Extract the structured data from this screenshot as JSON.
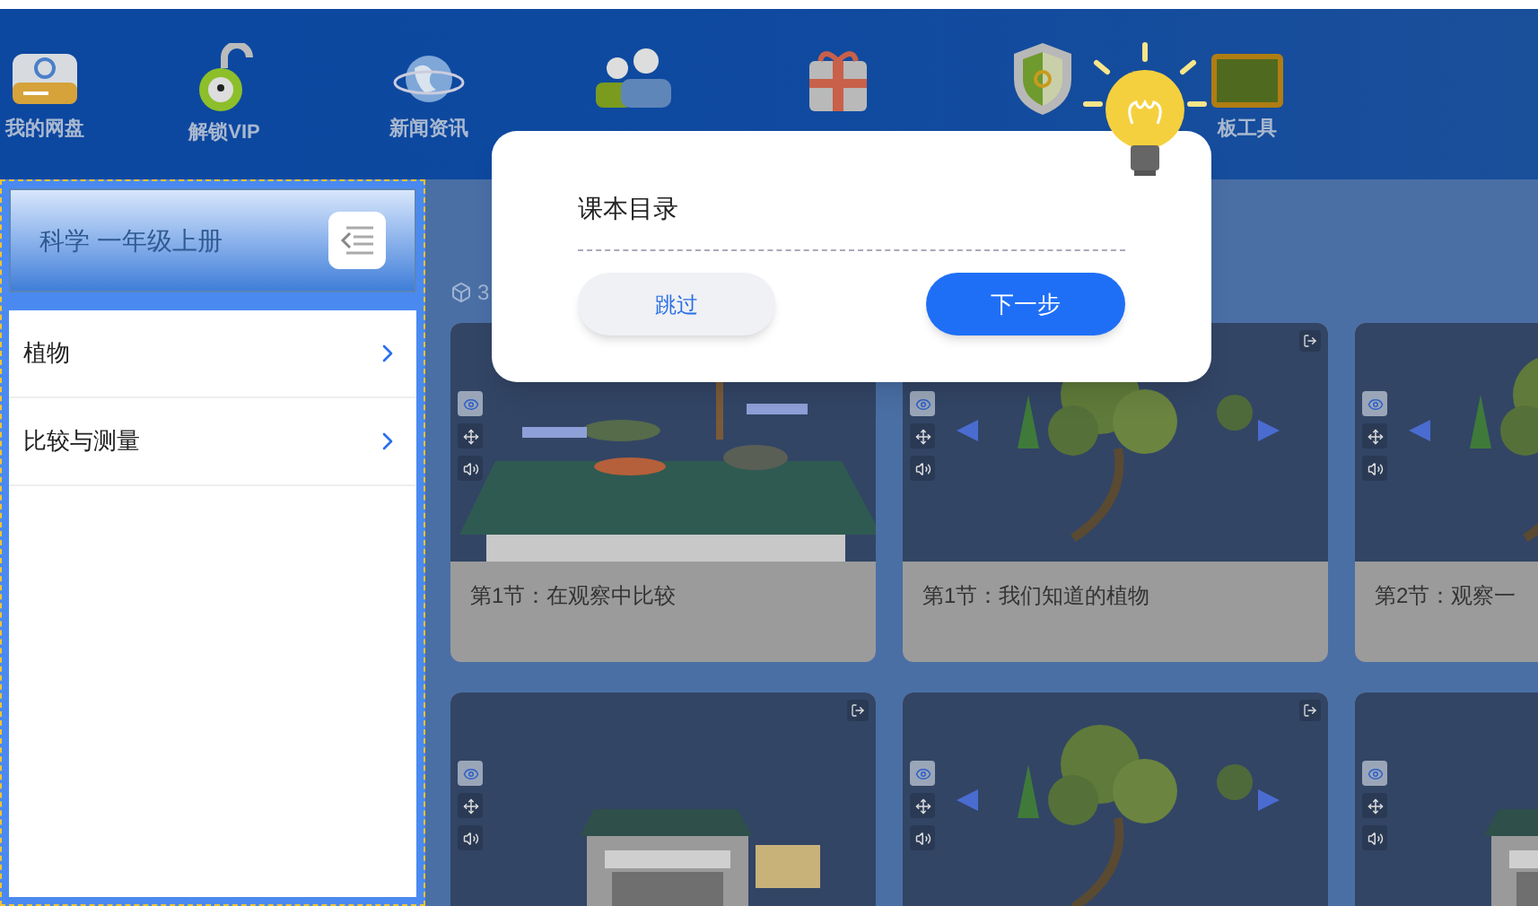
{
  "toolbar": {
    "items": [
      {
        "label": "我的网盘",
        "kind": "disk"
      },
      {
        "label": "解锁VIP",
        "kind": "lock"
      },
      {
        "label": "新闻资讯",
        "kind": "globe"
      },
      {
        "kind": "people"
      },
      {
        "kind": "gift"
      },
      {
        "kind": "shield"
      },
      {
        "label": "板工具",
        "kind": "board"
      }
    ]
  },
  "sidebar": {
    "title": "科学 一年级上册",
    "items": [
      {
        "label": "植物"
      },
      {
        "label": "比较与测量"
      }
    ]
  },
  "section": {
    "label": "3"
  },
  "cards": [
    {
      "title": "第1节：在观察中比较",
      "kind": "dino",
      "exit": false
    },
    {
      "title": "第1节：我们知道的植物",
      "kind": "tree",
      "exit": true
    },
    {
      "title": "第2节：观察一",
      "kind": "tree",
      "exit": false
    },
    {
      "kind": "desk",
      "exit": true
    },
    {
      "kind": "tree",
      "exit": true
    },
    {
      "kind": "desk",
      "exit": false
    }
  ],
  "popup": {
    "title": "课本目录",
    "buttons": [
      {
        "label": "跳过",
        "kind": "secondary"
      },
      {
        "label": "下一步",
        "kind": "primary"
      }
    ]
  }
}
